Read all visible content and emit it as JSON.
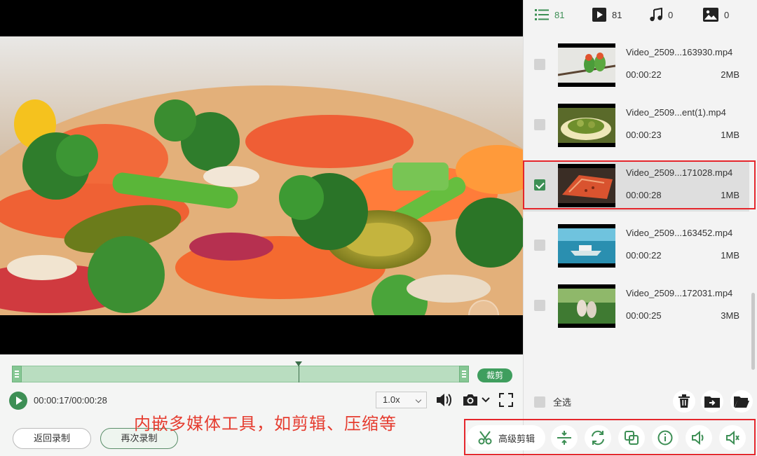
{
  "player": {
    "current_time": "00:00:17/",
    "total_time": "00:00:28",
    "speed": "1.0x",
    "cut_label": "裁剪",
    "trim_progress": 0.627
  },
  "actions": {
    "return_label": "返回录制",
    "record_again_label": "再次录制"
  },
  "caption": "内嵌多媒体工具，如剪辑、压缩等",
  "tabs": [
    {
      "icon": "list-icon",
      "count": "81"
    },
    {
      "icon": "video-icon",
      "count": "81"
    },
    {
      "icon": "music-icon",
      "count": "0"
    },
    {
      "icon": "image-icon",
      "count": "0"
    }
  ],
  "files": [
    {
      "name": "Video_2509...163930.mp4",
      "duration": "00:00:22",
      "size": "2MB",
      "checked": false
    },
    {
      "name": "Video_2509...ent(1).mp4",
      "duration": "00:00:23",
      "size": "1MB",
      "checked": false
    },
    {
      "name": "Video_2509...171028.mp4",
      "duration": "00:00:28",
      "size": "1MB",
      "checked": true
    },
    {
      "name": "Video_2509...163452.mp4",
      "duration": "00:00:22",
      "size": "1MB",
      "checked": false
    },
    {
      "name": "Video_2509...172031.mp4",
      "duration": "00:00:25",
      "size": "3MB",
      "checked": false
    }
  ],
  "select_all_label": "全选",
  "toolbar": {
    "advanced_edit_label": "高级剪辑",
    "tools": [
      "compress-icon",
      "rotate-icon",
      "merge-icon",
      "info-icon",
      "volume-icon",
      "audio-icon"
    ]
  },
  "colors": {
    "accent": "#3d8f55",
    "highlight": "#e5262c",
    "caption": "#e53c2f"
  }
}
